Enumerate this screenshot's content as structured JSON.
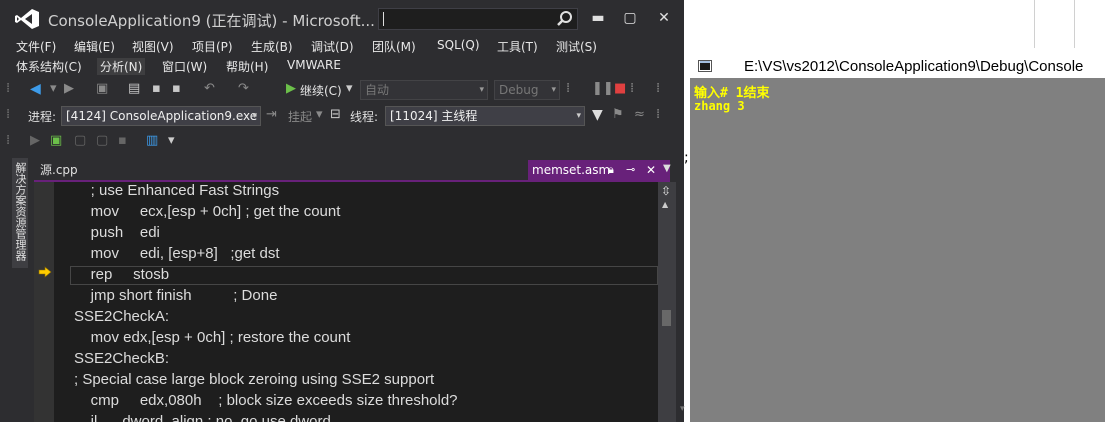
{
  "window": {
    "title": "ConsoleApplication9 (正在调试) - Microsoft...",
    "controls": {
      "minimize": "▬",
      "maximize": "▢",
      "close": "✕"
    }
  },
  "menu_row1": [
    "文件(F)",
    "编辑(E)",
    "视图(V)",
    "项目(P)",
    "生成(B)",
    "调试(D)",
    "团队(M)",
    "SQL(Q)",
    "工具(T)",
    "测试(S)"
  ],
  "menu_row2": [
    "体系结构(C)",
    "分析(N)",
    "窗口(W)",
    "帮助(H)",
    "VMWARE"
  ],
  "toolbar": {
    "solution_config": "自动",
    "build_config": "Debug",
    "continue_label": "继续(C)"
  },
  "debug_toolbar": {
    "process_label": "进程:",
    "process_value": "[4124] ConsoleApplication9.exe",
    "suspend_label": "挂起",
    "thread_label": "线程:",
    "thread_value": "[11024] 主线程"
  },
  "side_tab": {
    "label": "解决方案资源管理器"
  },
  "doc_tabs": {
    "tab1": "源.cpp",
    "tab2": "memset.asm"
  },
  "code_lines": [
    "    ; use Enhanced Fast Strings",
    "    mov     ecx,[esp + 0ch] ; get the count",
    "    push    edi",
    "    mov     edi, [esp+8]   ;get dst",
    "    rep     stosb",
    "    jmp short finish          ; Done",
    "SSE2CheckA:",
    "    mov edx,[esp + 0ch] ; restore the count",
    "SSE2CheckB:",
    "; Special case large block zeroing using SSE2 support",
    "    cmp     edx,080h    ; block size exceeds size threshold?",
    "    jl      dword_align ; no, go use dword"
  ],
  "console": {
    "title": "E:\\VS\\vs2012\\ConsoleApplication9\\Debug\\Console",
    "lines": [
      "输入# 1结束",
      "zhang 3"
    ]
  },
  "colors": {
    "vs_bg": "#2d2d30",
    "editor_bg": "#1e1e1e",
    "tab_accent": "#68217a",
    "console_bg": "#808080",
    "console_text": "#ffff00"
  }
}
